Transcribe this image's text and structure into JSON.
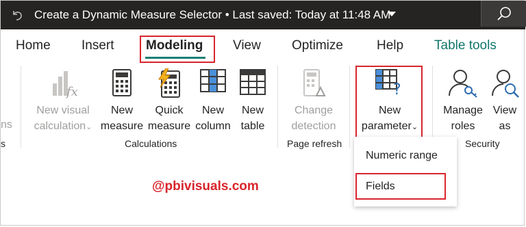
{
  "window": {
    "title": "Create a Dynamic Measure Selector • Last saved: Today at 11:48 AM"
  },
  "tabs": [
    {
      "label": "Home"
    },
    {
      "label": "Insert"
    },
    {
      "label": "Modeling"
    },
    {
      "label": "View"
    },
    {
      "label": "Optimize"
    },
    {
      "label": "Help"
    },
    {
      "label": "Table tools"
    }
  ],
  "ribbon": {
    "partial_left_label": "ns",
    "partial_left_group": "s",
    "buttons": {
      "new_visual_calculation": {
        "line1": "New visual",
        "line2": "calculation"
      },
      "new_measure": {
        "line1": "New",
        "line2": "measure"
      },
      "quick_measure": {
        "line1": "Quick",
        "line2": "measure"
      },
      "new_column": {
        "line1": "New",
        "line2": "column"
      },
      "new_table": {
        "line1": "New",
        "line2": "table"
      },
      "change_detection": {
        "line1": "Change",
        "line2": "detection"
      },
      "new_parameter": {
        "line1": "New",
        "line2": "parameter"
      },
      "manage_roles": {
        "line1": "Manage",
        "line2": "roles"
      },
      "view_as": {
        "line1": "View",
        "line2": "as"
      }
    },
    "groups": {
      "calculations": "Calculations",
      "page_refresh": "Page refresh",
      "security": "Security"
    }
  },
  "dropdown": {
    "items": [
      "Numeric range",
      "Fields"
    ]
  },
  "watermark": "@pbivisuals.com",
  "colors": {
    "titlebar": "#252423",
    "accent": "#1a7f74",
    "highlight": "#d9242c"
  }
}
